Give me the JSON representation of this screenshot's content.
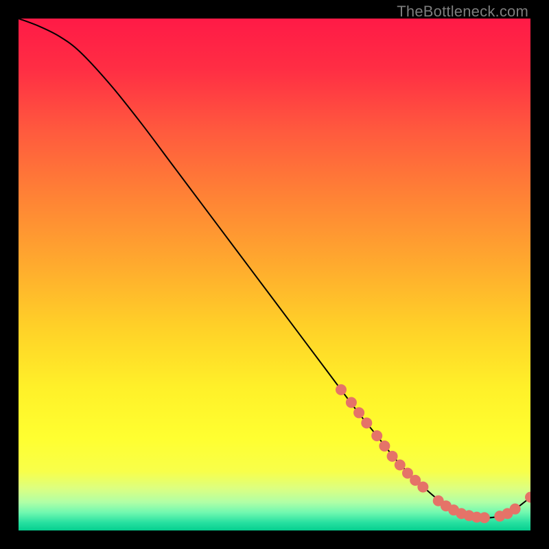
{
  "watermark": "TheBottleneck.com",
  "chart_data": {
    "type": "line",
    "title": "",
    "xlabel": "",
    "ylabel": "",
    "xlim": [
      0,
      100
    ],
    "ylim": [
      0,
      100
    ],
    "series": [
      {
        "name": "curve",
        "x": [
          0,
          4,
          8,
          12,
          18,
          24,
          30,
          36,
          42,
          48,
          54,
          60,
          66,
          70,
          74,
          78,
          82,
          86,
          90,
          94,
          97,
          100
        ],
        "y": [
          100,
          98.5,
          96.5,
          93.5,
          87,
          79.5,
          71.5,
          63.5,
          55.5,
          47.5,
          39.5,
          31.5,
          23.5,
          18.5,
          13.5,
          9.5,
          6,
          3.5,
          2.5,
          2.8,
          4.2,
          6.5
        ]
      }
    ],
    "markers": {
      "name": "dots",
      "color": "#e57368",
      "points": [
        {
          "x": 63,
          "y": 27.5
        },
        {
          "x": 65,
          "y": 25.0
        },
        {
          "x": 66.5,
          "y": 23.0
        },
        {
          "x": 68,
          "y": 21.0
        },
        {
          "x": 70,
          "y": 18.5
        },
        {
          "x": 71.5,
          "y": 16.5
        },
        {
          "x": 73,
          "y": 14.5
        },
        {
          "x": 74.5,
          "y": 12.8
        },
        {
          "x": 76,
          "y": 11.2
        },
        {
          "x": 77.5,
          "y": 9.8
        },
        {
          "x": 79,
          "y": 8.5
        },
        {
          "x": 82,
          "y": 5.8
        },
        {
          "x": 83.5,
          "y": 4.8
        },
        {
          "x": 85,
          "y": 4.0
        },
        {
          "x": 86.5,
          "y": 3.3
        },
        {
          "x": 88,
          "y": 2.9
        },
        {
          "x": 89.5,
          "y": 2.6
        },
        {
          "x": 91,
          "y": 2.5
        },
        {
          "x": 94,
          "y": 2.8
        },
        {
          "x": 95.5,
          "y": 3.3
        },
        {
          "x": 97,
          "y": 4.2
        },
        {
          "x": 100,
          "y": 6.5
        }
      ]
    },
    "gradient_stops": [
      {
        "offset": 0.0,
        "color": "#ff1a46"
      },
      {
        "offset": 0.1,
        "color": "#ff2e44"
      },
      {
        "offset": 0.22,
        "color": "#ff5a3e"
      },
      {
        "offset": 0.35,
        "color": "#ff8335"
      },
      {
        "offset": 0.48,
        "color": "#ffaa2e"
      },
      {
        "offset": 0.6,
        "color": "#ffd028"
      },
      {
        "offset": 0.72,
        "color": "#fff029"
      },
      {
        "offset": 0.82,
        "color": "#ffff30"
      },
      {
        "offset": 0.885,
        "color": "#f8ff4a"
      },
      {
        "offset": 0.918,
        "color": "#dcff81"
      },
      {
        "offset": 0.945,
        "color": "#b0ffa6"
      },
      {
        "offset": 0.965,
        "color": "#70f8b0"
      },
      {
        "offset": 0.985,
        "color": "#26e0a0"
      },
      {
        "offset": 1.0,
        "color": "#06cf8f"
      }
    ]
  }
}
